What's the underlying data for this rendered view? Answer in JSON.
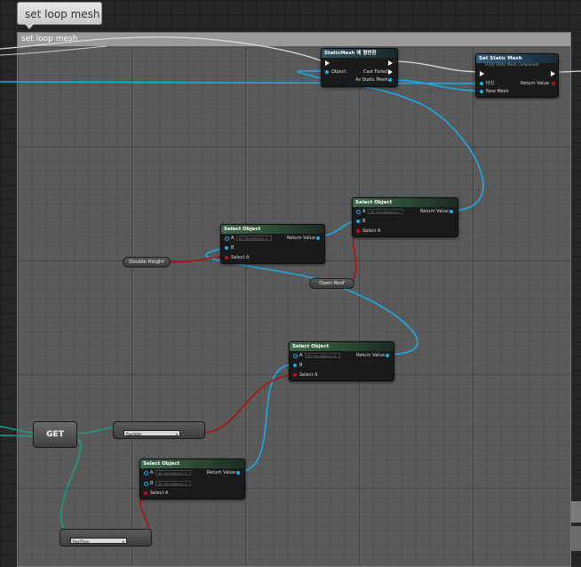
{
  "comment": {
    "bubble_text": "set loop mesh",
    "header_text": "set loop mesh"
  },
  "cast_node": {
    "title": "StaticMesh 에 형변환",
    "object_label": "Object",
    "cast_failed_label": "Cast Failed",
    "as_label": "As Static Mesh"
  },
  "set_mesh_node": {
    "title": "Set Static Mesh",
    "subtitle": "타깃은 Static Mesh Component",
    "target_label": "타깃",
    "new_mesh_label": "New Mesh",
    "return_label": "Return Value"
  },
  "select_nodes": [
    {
      "title": "Select Object",
      "a_label": "A",
      "a_value": "BA_DomeRoom1 ▾",
      "b_label": "B",
      "select_label": "Select A",
      "return_label": "Return Value"
    },
    {
      "title": "Select Object",
      "a_label": "A",
      "a_value": "BA_DomeRoom1 ▾",
      "b_label": "B",
      "select_label": "Select A",
      "return_label": "Return Value"
    },
    {
      "title": "Select Object",
      "a_label": "A",
      "a_value": "BA_DomeRoom1 ▾",
      "b_label": "B",
      "select_label": "Select A",
      "return_label": "Return Value"
    },
    {
      "title": "Select Object",
      "a_label": "A",
      "a_value": "BA_DomeRoom1 ▾",
      "b_label": "B",
      "b_value": "BA_DomeRoom1 ▾",
      "select_label": "Select A",
      "return_label": "Return Value"
    }
  ],
  "variables": {
    "double_height": "Double Height",
    "open_roof": "Open Roof"
  },
  "get_node": {
    "label": "GET"
  },
  "enum_nodes": {
    "first_value": "Roofable",
    "second_value": "RoofType"
  },
  "colors": {
    "exec": "#ffffff",
    "object_pin": "#16aef0",
    "bool_pin": "#c01010",
    "teal_wire": "#1a9e8a"
  }
}
